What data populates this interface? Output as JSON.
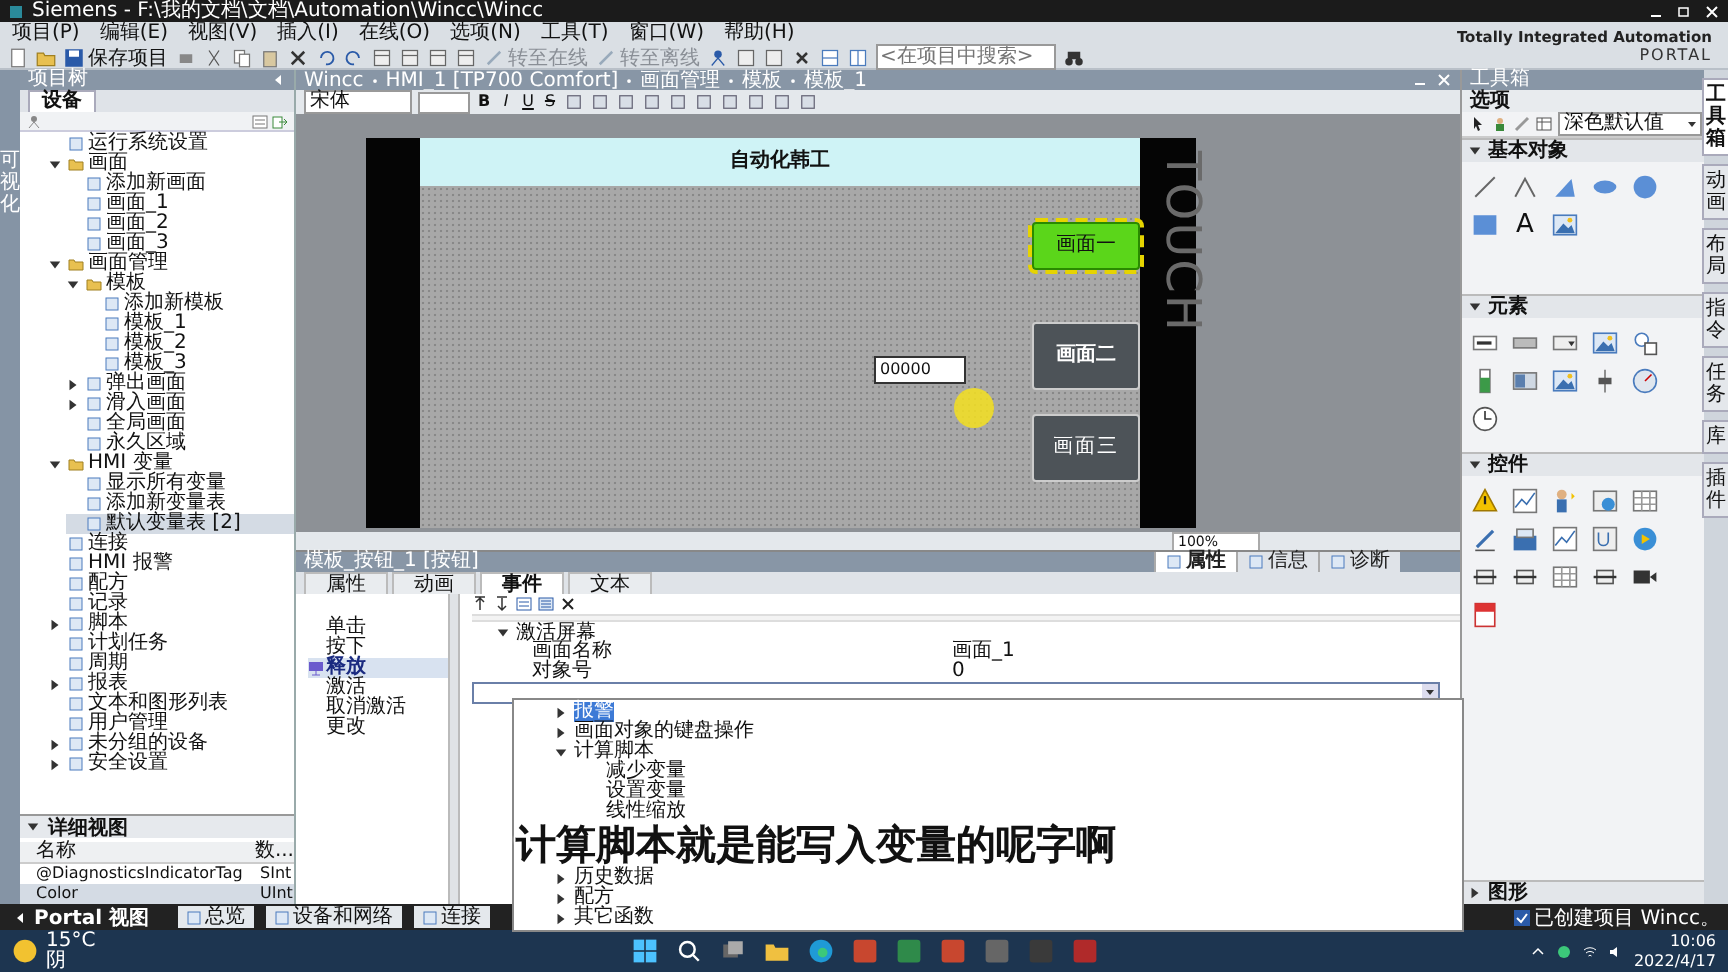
{
  "window": {
    "title": "Siemens  -  F:\\我的文档\\文档\\Automation\\Wincc\\Wincc"
  },
  "menu": [
    "项目(P)",
    "编辑(E)",
    "视图(V)",
    "插入(I)",
    "在线(O)",
    "选项(N)",
    "工具(T)",
    "窗口(W)",
    "帮助(H)"
  ],
  "toolbar": {
    "save": "保存项目",
    "go_online": "转至在线",
    "go_offline": "转至离线",
    "search": {
      "placeholder": "<在项目中搜索>"
    }
  },
  "brand": {
    "line1": "Totally Integrated Automation",
    "line2": "PORTAL"
  },
  "side_strip": {
    "label": "可视化"
  },
  "project_tree": {
    "title": "项目树",
    "tab": "设备",
    "items": [
      {
        "label": "运行系统设置",
        "selected": false
      },
      {
        "label": "画面",
        "expanded": true,
        "selected": false,
        "children": [
          {
            "label": "添加新画面",
            "selected": false
          },
          {
            "label": "画面_1",
            "selected": false
          },
          {
            "label": "画面_2",
            "selected": false
          },
          {
            "label": "画面_3",
            "selected": false
          }
        ]
      },
      {
        "label": "画面管理",
        "expanded": true,
        "selected": false,
        "children": [
          {
            "label": "模板",
            "expanded": true,
            "selected": false,
            "children": [
              {
                "label": "添加新模板",
                "selected": false
              },
              {
                "label": "模板_1",
                "selected": false
              },
              {
                "label": "模板_2",
                "selected": false
              },
              {
                "label": "模板_3",
                "selected": false
              }
            ]
          },
          {
            "label": "弹出画面",
            "expanded": false,
            "selected": false
          },
          {
            "label": "滑入画面",
            "expanded": false,
            "selected": false
          },
          {
            "label": "全局画面",
            "selected": false
          },
          {
            "label": "永久区域",
            "selected": false
          }
        ]
      },
      {
        "label": "HMI 变量",
        "expanded": true,
        "selected": false,
        "children": [
          {
            "label": "显示所有变量",
            "selected": false
          },
          {
            "label": "添加新变量表",
            "selected": false
          },
          {
            "label": "默认变量表 [2]",
            "selected": true
          }
        ]
      },
      {
        "label": "连接",
        "selected": false
      },
      {
        "label": "HMI 报警",
        "selected": false
      },
      {
        "label": "配方",
        "selected": false
      },
      {
        "label": "记录",
        "selected": false
      },
      {
        "label": "脚本",
        "expanded": false,
        "selected": false
      },
      {
        "label": "计划任务",
        "selected": false
      },
      {
        "label": "周期",
        "selected": false
      },
      {
        "label": "报表",
        "expanded": false,
        "selected": false
      },
      {
        "label": "文本和图形列表",
        "selected": false
      },
      {
        "label": "用户管理",
        "selected": false
      },
      {
        "label": "未分组的设备",
        "expanded": false,
        "selected": false
      },
      {
        "label": "安全设置",
        "expanded": false,
        "selected": false
      }
    ]
  },
  "detail_view": {
    "title": "详细视图",
    "columns": [
      "名称",
      "数..."
    ],
    "rows": [
      {
        "cells": [
          "@DiagnosticsIndicatorTag",
          "SInt"
        ],
        "selected": false
      },
      {
        "cells": [
          "Color",
          "UInt"
        ],
        "selected": true
      }
    ]
  },
  "editor": {
    "breadcrumb": [
      "Wincc",
      "HMI_1 [TP700 Comfort]",
      "画面管理",
      "模板",
      "模板_1"
    ],
    "font": "宋体",
    "format_buttons": [
      "B",
      "I",
      "U",
      "S"
    ],
    "zoom": "100%",
    "screen": {
      "header": "自动化韩工",
      "side_text": "TOUCH",
      "io_field": "00000",
      "buttons": [
        {
          "label": "画面一",
          "selected": true
        },
        {
          "label": "画面二",
          "selected": false
        },
        {
          "label": "画面三",
          "selected": false
        }
      ]
    }
  },
  "properties": {
    "title": "模板_按钮_1 [按钮]",
    "tabs": [
      {
        "label": "属性",
        "selected": false
      },
      {
        "label": "动画",
        "selected": false
      },
      {
        "label": "事件",
        "selected": true
      },
      {
        "label": "文本",
        "selected": false
      }
    ],
    "view_tabs": [
      {
        "label": "属性",
        "selected": true
      },
      {
        "label": "信息",
        "selected": false
      },
      {
        "label": "诊断",
        "selected": false
      }
    ],
    "events": [
      {
        "label": "单击",
        "selected": false
      },
      {
        "label": "按下",
        "selected": false
      },
      {
        "label": "释放",
        "selected": true
      },
      {
        "label": "激活",
        "selected": false
      },
      {
        "label": "取消激活",
        "selected": false
      },
      {
        "label": "更改",
        "selected": false
      }
    ],
    "function": {
      "title": "激活屏幕",
      "expanded": true,
      "params": [
        {
          "name": "画面名称",
          "value": "画面_1"
        },
        {
          "name": "对象号",
          "value": "0"
        }
      ]
    },
    "dropdown": [
      {
        "label": "报警",
        "expanded": false,
        "selected": true
      },
      {
        "label": "画面对象的键盘操作",
        "expanded": false,
        "selected": false
      },
      {
        "label": "计算脚本",
        "expanded": true,
        "selected": false,
        "children": [
          {
            "label": "减少变量",
            "selected": false
          },
          {
            "label": "设置变量",
            "selected": false
          },
          {
            "label": "线性缩放",
            "selected": false
          }
        ]
      },
      {
        "label": "历史数据",
        "expanded": false,
        "selected": false
      },
      {
        "label": "配方",
        "expanded": false,
        "selected": false
      },
      {
        "label": "其它函数",
        "expanded": false,
        "selected": false
      }
    ],
    "subtitle": "计算脚本就是能写入变量的呢字啊"
  },
  "toolbox": {
    "title": "工具箱",
    "options": "选项",
    "style": "深色默认值",
    "sections": [
      {
        "kind": "basic",
        "title": "基本对象",
        "expanded": true,
        "text_tool": "A"
      },
      {
        "kind": "elements",
        "title": "元素",
        "expanded": true
      },
      {
        "kind": "controls",
        "title": "控件",
        "expanded": true
      },
      {
        "kind": "graphics",
        "title": "图形",
        "expanded": false
      }
    ]
  },
  "side_tabs": [
    {
      "label": "工具箱",
      "selected": true
    },
    {
      "label": "动画",
      "selected": false
    },
    {
      "label": "布局",
      "selected": false
    },
    {
      "label": "指令",
      "selected": false
    },
    {
      "label": "任务",
      "selected": false
    },
    {
      "label": "库",
      "selected": false
    },
    {
      "label": "插件",
      "selected": false
    }
  ],
  "bottom_bar": {
    "portal": "Portal 视图",
    "tabs": [
      "总览",
      "设备和网络",
      "连接"
    ],
    "status": "已创建项目 Wincc。"
  },
  "taskbar": {
    "weather": {
      "temp": "15°C",
      "condition": "阴"
    },
    "time": "10:06",
    "date": "2022/4/17"
  }
}
